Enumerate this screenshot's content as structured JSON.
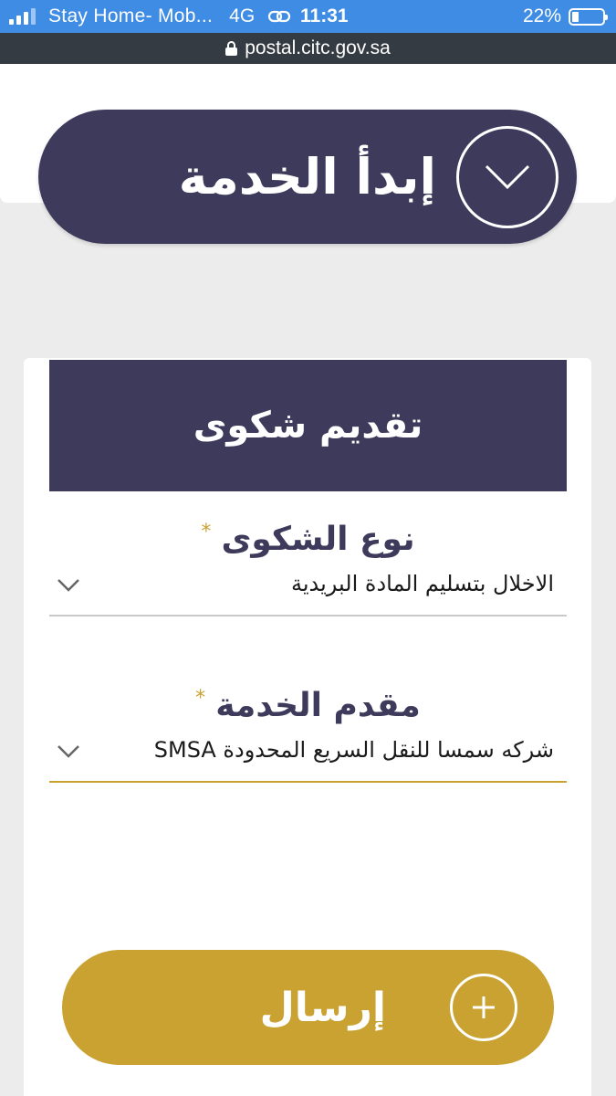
{
  "status_bar": {
    "carrier": "Stay Home- Mob...",
    "network": "4G",
    "time": "11:31",
    "battery": "22%",
    "battery_level": 0.22
  },
  "browser": {
    "url": "postal.citc.gov.sa"
  },
  "start_service": {
    "label": "إبدأ الخدمة",
    "icon": "chevron-down-icon"
  },
  "complaint_form": {
    "title": "تقديم شكوى",
    "fields": [
      {
        "label": "نوع الشكوى",
        "required_mark": "*",
        "value": "الاخلال بتسليم المادة البريدية"
      },
      {
        "label": "مقدم الخدمة",
        "required_mark": "*",
        "value": "شركه سمسا للنقل السريع المحدودة SMSA"
      }
    ],
    "submit_label": "إرسال",
    "submit_icon": "plus-icon"
  },
  "colors": {
    "primary": "#3e3a5b",
    "accent": "#c9a232",
    "status_bar": "#3f8ce4",
    "url_bar": "#343b42"
  }
}
